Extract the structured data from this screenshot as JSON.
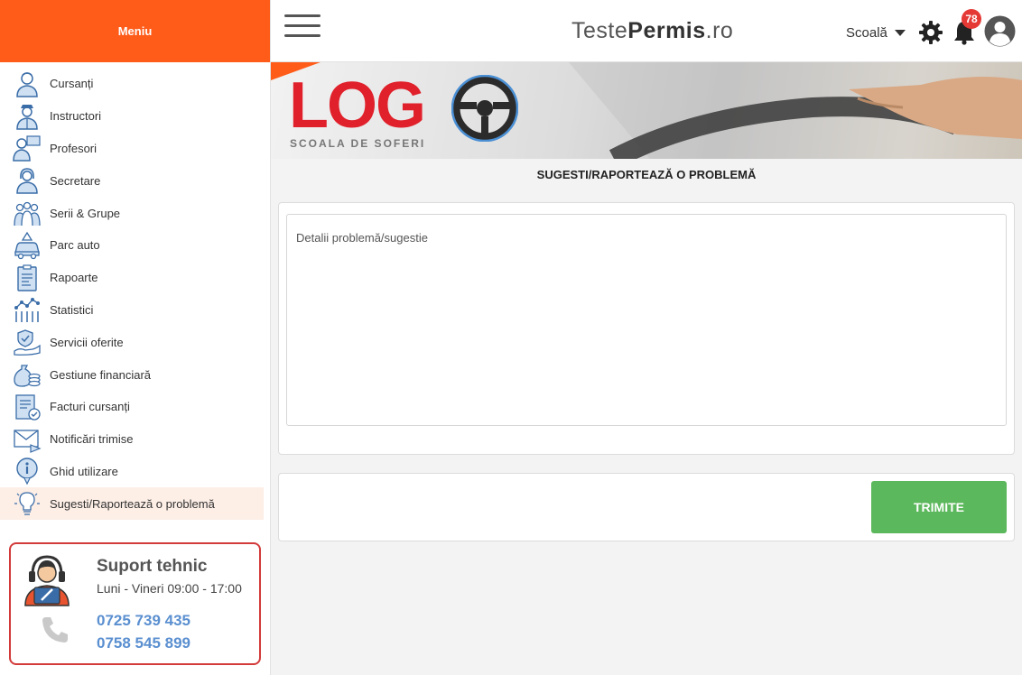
{
  "sidebar": {
    "title": "Meniu",
    "items": [
      {
        "label": "Cursanți",
        "icon": "student-icon"
      },
      {
        "label": "Instructori",
        "icon": "instructor-icon"
      },
      {
        "label": "Profesori",
        "icon": "teacher-icon"
      },
      {
        "label": "Secretare",
        "icon": "secretary-icon"
      },
      {
        "label": "Serii & Grupe",
        "icon": "groups-icon"
      },
      {
        "label": "Parc auto",
        "icon": "car-icon"
      },
      {
        "label": "Rapoarte",
        "icon": "report-icon"
      },
      {
        "label": "Statistici",
        "icon": "statistics-icon"
      },
      {
        "label": "Servicii oferite",
        "icon": "services-icon"
      },
      {
        "label": "Gestiune financiară",
        "icon": "finance-icon"
      },
      {
        "label": "Facturi cursanți",
        "icon": "invoice-icon"
      },
      {
        "label": "Notificări trimise",
        "icon": "notification-mail-icon"
      },
      {
        "label": "Ghid utilizare",
        "icon": "guide-icon"
      },
      {
        "label": "Sugesti/Raportează o problemă",
        "icon": "suggestion-icon",
        "active": true
      }
    ],
    "support": {
      "title": "Suport tehnic",
      "hours": "Luni - Vineri 09:00 - 17:00",
      "phones": [
        "0725 739 435",
        "0758 545 899"
      ]
    }
  },
  "header": {
    "brand_light": "Teste",
    "brand_bold": "Permis",
    "brand_suffix": ".ro",
    "school_label": "Scoală",
    "notification_count": "78"
  },
  "banner": {
    "logo": "LOG",
    "tagline": "SCOALA DE SOFERI"
  },
  "main": {
    "title": "SUGESTI/RAPORTEAZĂ O PROBLEMĂ",
    "textarea_placeholder": "Detalii problemă/sugestie",
    "submit_label": "TRIMITE"
  },
  "colors": {
    "accent": "#ff5c1a",
    "submit": "#5cb85c",
    "badge": "#e53935",
    "phone": "#5a8fd0",
    "support_border": "#d33a3a"
  }
}
